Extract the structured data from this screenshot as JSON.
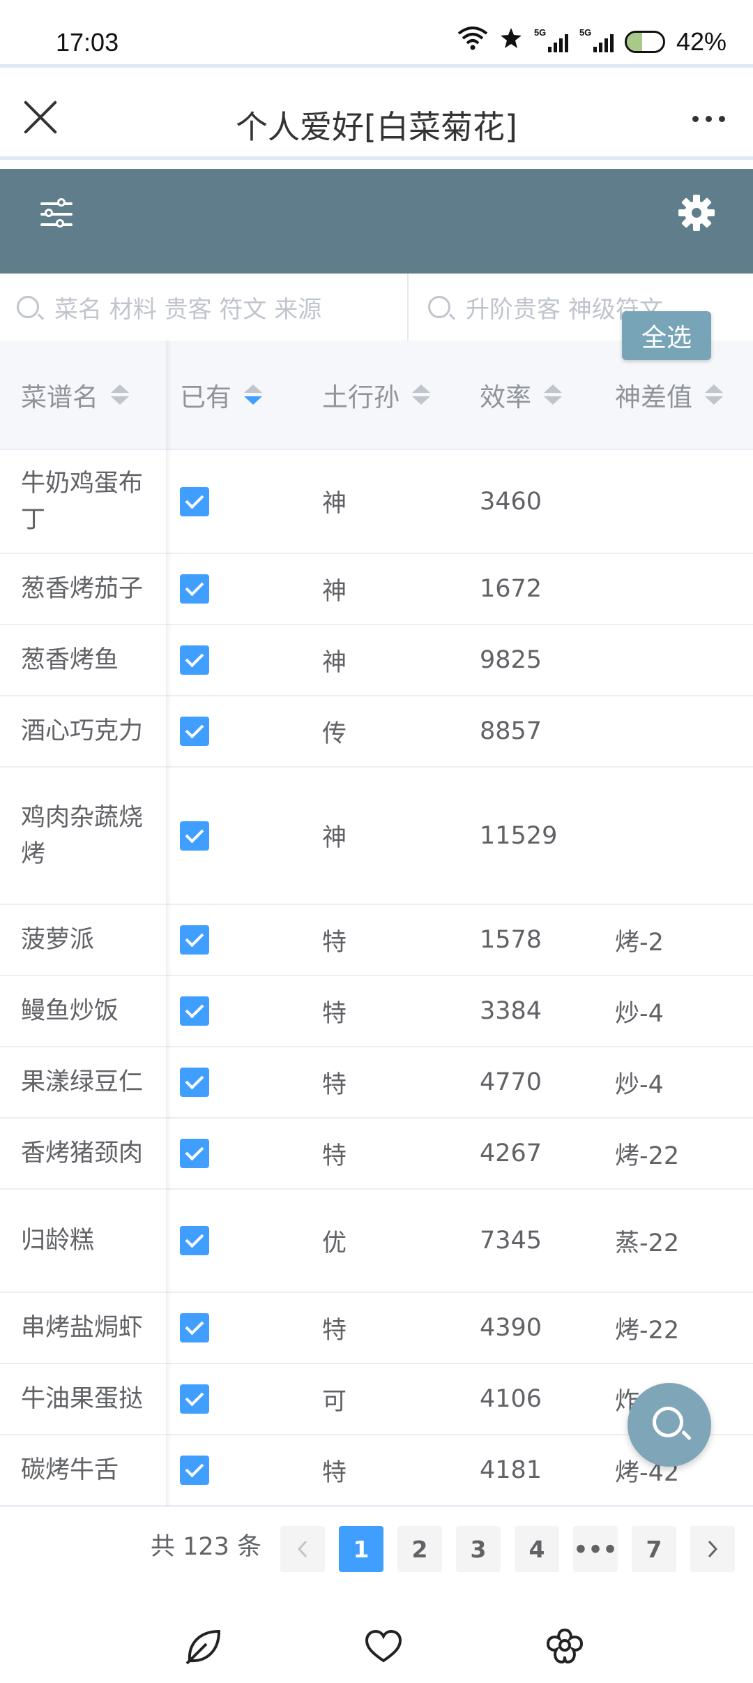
{
  "status_bar": {
    "time": "17:03",
    "battery": "42%",
    "signal1_label": "5G",
    "signal2_label": "5G"
  },
  "header": {
    "title": "个人爱好[白菜菊花]",
    "close_icon": "close-icon",
    "more_icon": "more-icon"
  },
  "toolbar": {
    "filter_icon": "sliders-icon",
    "settings_icon": "gear-icon",
    "accent": "#607d8b"
  },
  "search": {
    "left_placeholder": "菜名 材料 贵客 符文 来源",
    "right_placeholder": "升阶贵客 神级符文",
    "select_all": "全选"
  },
  "table": {
    "columns": [
      "菜谱名",
      "已有",
      "土行孙",
      "效率",
      "神差值"
    ],
    "sorted_column": "已有",
    "rows": [
      {
        "name": "牛奶鸡蛋布丁",
        "owned": true,
        "grade": "神",
        "efficiency": "3460",
        "diff": ""
      },
      {
        "name": "葱香烤茄子",
        "owned": true,
        "grade": "神",
        "efficiency": "1672",
        "diff": ""
      },
      {
        "name": "葱香烤鱼",
        "owned": true,
        "grade": "神",
        "efficiency": "9825",
        "diff": ""
      },
      {
        "name": "酒心巧克力",
        "owned": true,
        "grade": "传",
        "efficiency": "8857",
        "diff": ""
      },
      {
        "name": "鸡肉杂蔬烧烤",
        "owned": true,
        "grade": "神",
        "efficiency": "11529",
        "diff": ""
      },
      {
        "name": "菠萝派",
        "owned": true,
        "grade": "特",
        "efficiency": "1578",
        "diff": "烤-2"
      },
      {
        "name": "鳗鱼炒饭",
        "owned": true,
        "grade": "特",
        "efficiency": "3384",
        "diff": "炒-4"
      },
      {
        "name": "果漾绿豆仁",
        "owned": true,
        "grade": "特",
        "efficiency": "4770",
        "diff": "炒-4"
      },
      {
        "name": "香烤猪颈肉",
        "owned": true,
        "grade": "特",
        "efficiency": "4267",
        "diff": "烤-22"
      },
      {
        "name": "归龄糕",
        "owned": true,
        "grade": "优",
        "efficiency": "7345",
        "diff": "蒸-22"
      },
      {
        "name": "串烤盐焗虾",
        "owned": true,
        "grade": "特",
        "efficiency": "4390",
        "diff": "烤-22"
      },
      {
        "name": "牛油果蛋挞",
        "owned": true,
        "grade": "可",
        "efficiency": "4106",
        "diff": "炸"
      },
      {
        "name": "碳烤牛舌",
        "owned": true,
        "grade": "特",
        "efficiency": "4181",
        "diff": "烤-42"
      }
    ]
  },
  "pagination": {
    "total": "共 123 条",
    "pages": [
      "1",
      "2",
      "3",
      "4",
      "•••",
      "7"
    ],
    "current": "1",
    "prev_icon": "chevron-left-icon",
    "next_icon": "chevron-right-icon"
  },
  "fab": {
    "icon": "search-icon",
    "color": "#7fa5b8"
  },
  "bottom_nav": [
    "leaf-icon",
    "heart-icon",
    "flower-icon"
  ],
  "colors": {
    "primary": "#409eff",
    "header_bg": "#607d8b"
  }
}
